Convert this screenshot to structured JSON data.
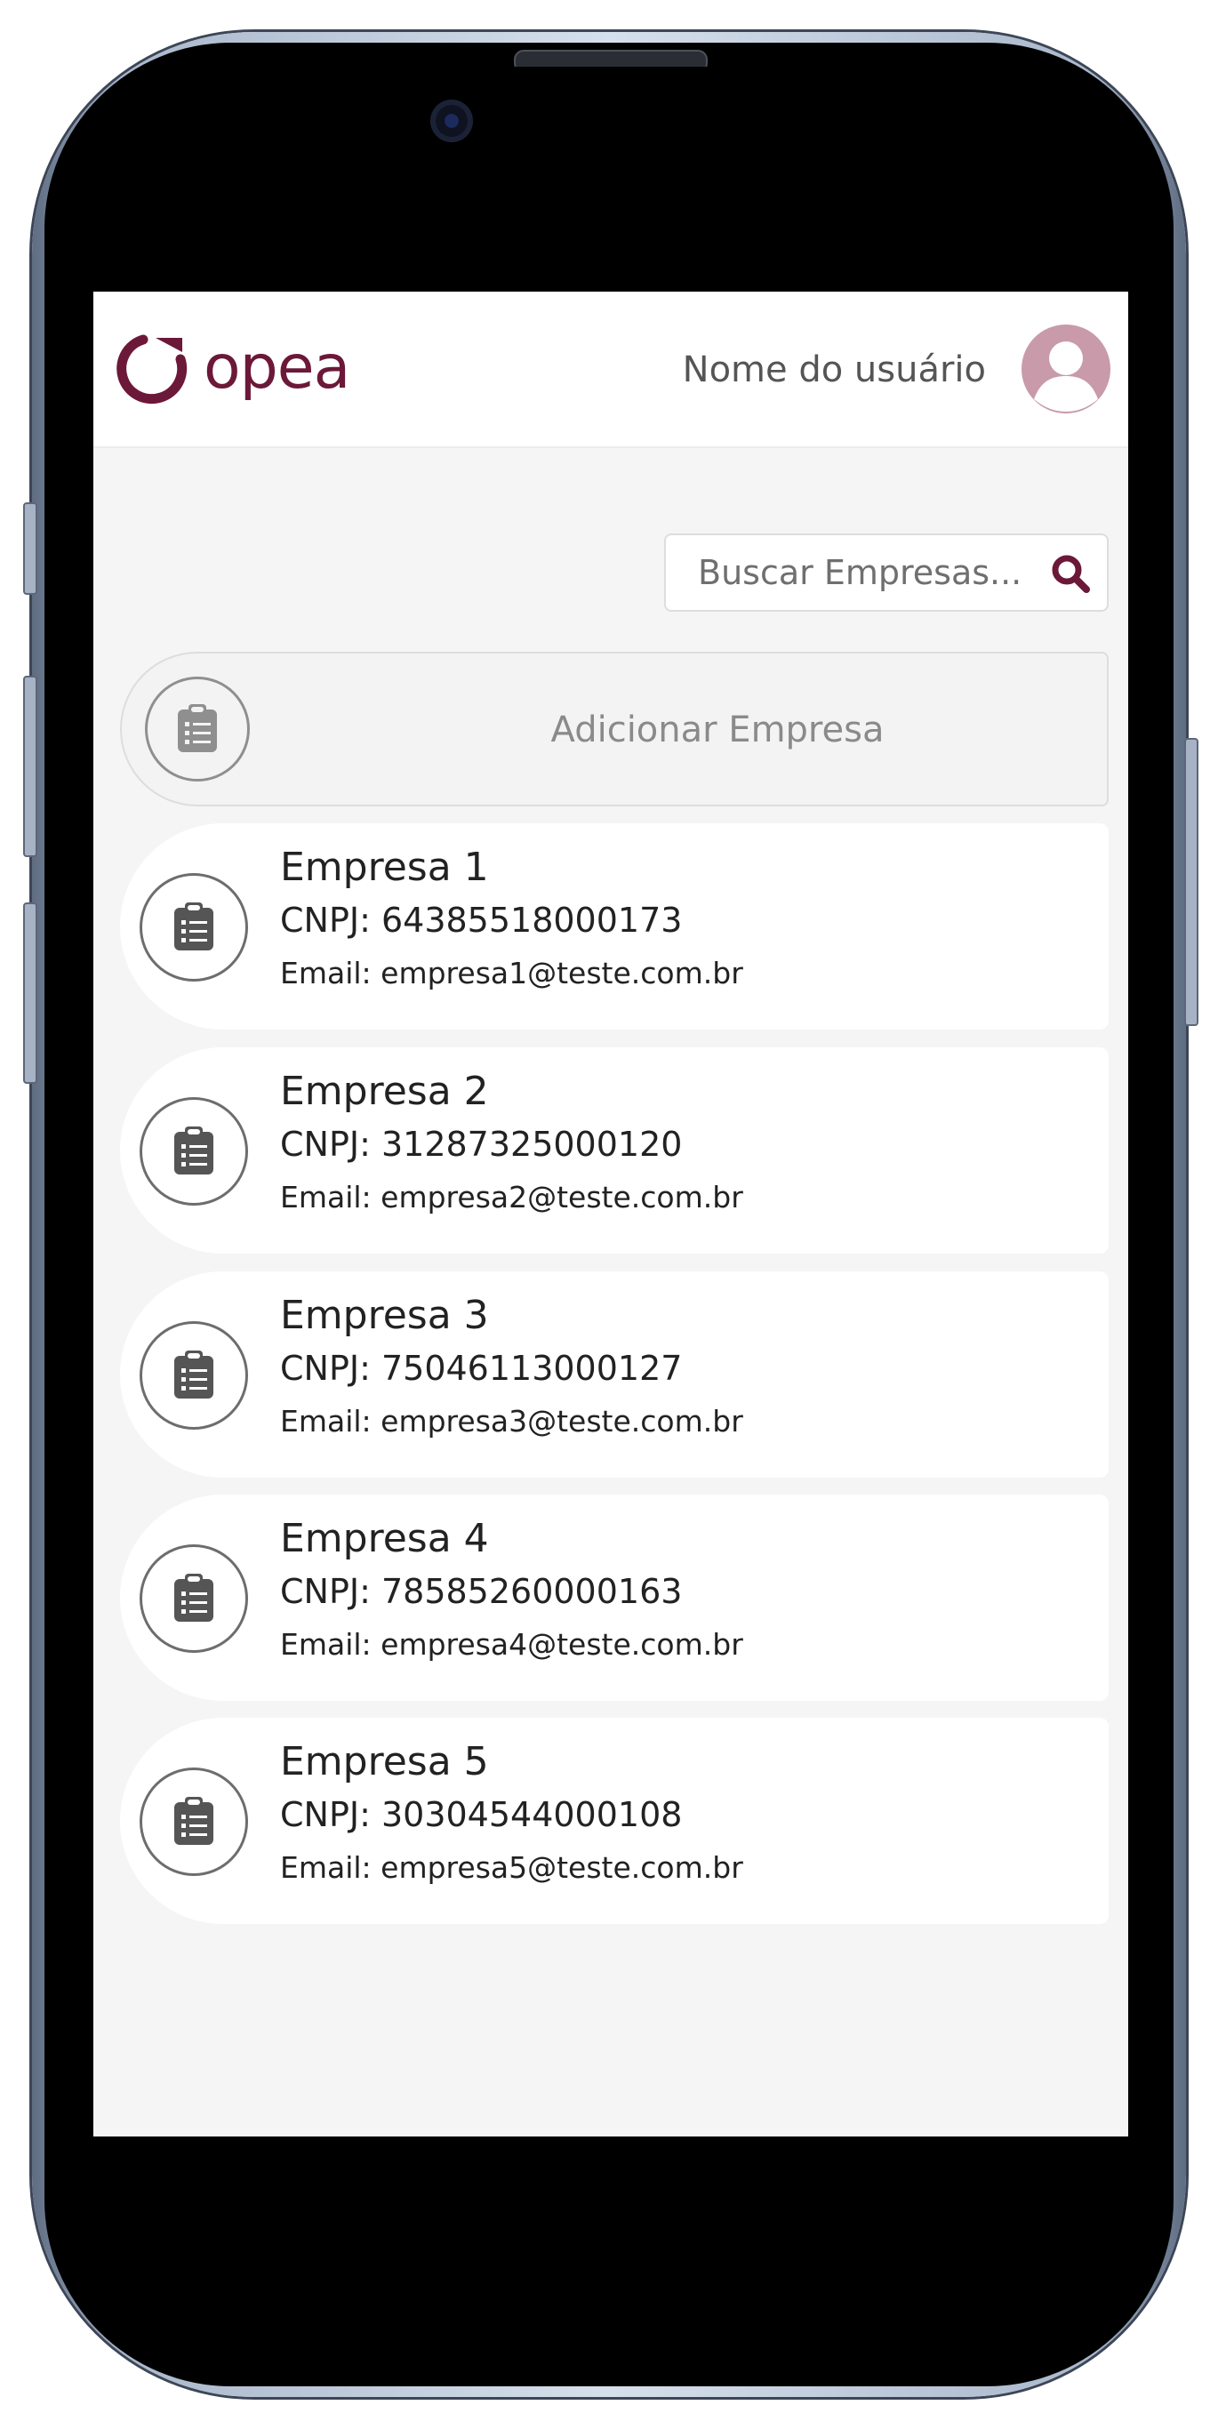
{
  "brand": {
    "name": "opea",
    "color": "#6c1838"
  },
  "header": {
    "user_name": "Nome do usuário"
  },
  "search": {
    "placeholder": "Buscar Empresas..."
  },
  "add_company": {
    "label": "Adicionar Empresa"
  },
  "companies": [
    {
      "name": "Empresa 1",
      "cnpj": "CNPJ: 64385518000173",
      "email": "Email: empresa1@teste.com.br"
    },
    {
      "name": "Empresa 2",
      "cnpj": "CNPJ: 31287325000120",
      "email": "Email: empresa2@teste.com.br"
    },
    {
      "name": "Empresa 3",
      "cnpj": "CNPJ: 75046113000127",
      "email": "Email: empresa3@teste.com.br"
    },
    {
      "name": "Empresa 4",
      "cnpj": "CNPJ: 78585260000163",
      "email": "Email: empresa4@teste.com.br"
    },
    {
      "name": "Empresa 5",
      "cnpj": "CNPJ: 30304544000108",
      "email": "Email: empresa5@teste.com.br"
    }
  ],
  "icons": {
    "logo": "opea-ring-logo",
    "avatar": "user-avatar-icon",
    "search": "magnifier-icon",
    "company": "clipboard-list-icon"
  },
  "colors": {
    "accent": "#6c1838",
    "avatar_bg": "#c89aaa",
    "screen_bg": "#f5f5f5",
    "card_bg": "#ffffff"
  }
}
